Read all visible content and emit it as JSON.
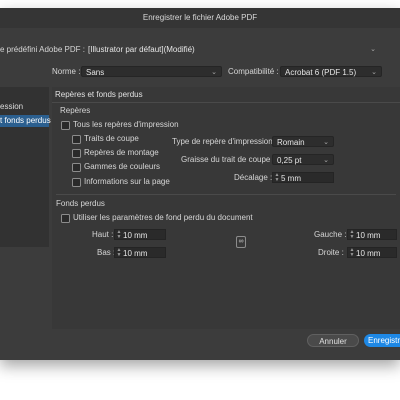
{
  "window": {
    "title": "Enregistrer le fichier Adobe PDF"
  },
  "preset": {
    "label": "e prédéfini Adobe PDF :",
    "value": "[Illustrator par défaut](Modifié)"
  },
  "standard": {
    "label": "Norme :",
    "value": "Sans"
  },
  "compatibility": {
    "label": "Compatibilité :",
    "value": "Acrobat 6 (PDF 1.5)"
  },
  "sidebar": {
    "items": [
      {
        "label": "ession",
        "selected": false
      },
      {
        "label": "t fonds perdus",
        "selected": true
      }
    ]
  },
  "section": {
    "title": "Repères et fonds perdus"
  },
  "marks": {
    "group_title": "Repères",
    "all_label": "Tous les repères d'impression",
    "trim_label": "Traits de coupe",
    "registration_label": "Repères de montage",
    "color_bars_label": "Gammes de couleurs",
    "page_info_label": "Informations sur la page",
    "type_label": "Type de repère d'impression :",
    "type_value": "Romain",
    "weight_label": "Graisse du trait de coupe :",
    "weight_value": "0,25 pt",
    "offset_label": "Décalage :",
    "offset_value": "5 mm"
  },
  "bleeds": {
    "group_title": "Fonds perdus",
    "use_doc_label": "Utiliser les paramètres de fond perdu du document",
    "top_label": "Haut :",
    "top_value": "10 mm",
    "bottom_label": "Bas :",
    "bottom_value": "10 mm",
    "left_label": "Gauche :",
    "left_value": "10 mm",
    "right_label": "Droite :",
    "right_value": "10 mm"
  },
  "buttons": {
    "cancel": "Annuler",
    "save": "Enregistrer"
  },
  "colors": {
    "accent": "#1e88e5",
    "background": "#3c3c3c",
    "selection": "#2b5f8f"
  }
}
